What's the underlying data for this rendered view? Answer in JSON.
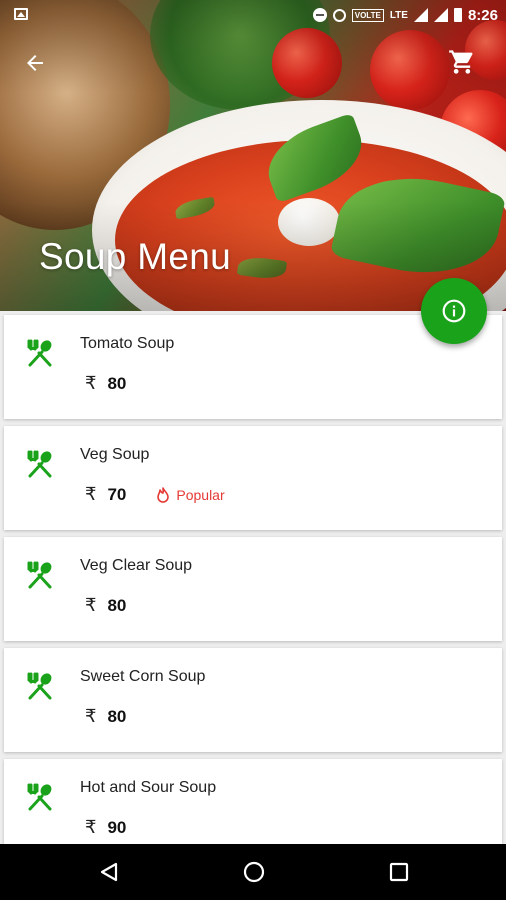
{
  "status_bar": {
    "time": "8:26",
    "volte": "VOLTE",
    "network": "LTE"
  },
  "header": {
    "title": "Soup Menu"
  },
  "colors": {
    "accent": "#1aa31a",
    "popular": "#e53935",
    "card_bg": "#ffffff",
    "nav_bg": "#000000"
  },
  "icons": {
    "back": "arrow-back-icon",
    "cart": "shopping-cart-icon",
    "info": "info-icon",
    "item": "fork-spoon-icon",
    "popular": "fire-icon"
  },
  "menu": {
    "items": [
      {
        "name": "Tomato Soup",
        "currency": "₹",
        "price": "80",
        "badge": ""
      },
      {
        "name": "Veg Soup",
        "currency": "₹",
        "price": "70",
        "badge": "Popular"
      },
      {
        "name": "Veg Clear Soup",
        "currency": "₹",
        "price": "80",
        "badge": ""
      },
      {
        "name": "Sweet Corn Soup",
        "currency": "₹",
        "price": "80",
        "badge": ""
      },
      {
        "name": "Hot and Sour Soup",
        "currency": "₹",
        "price": "90",
        "badge": ""
      }
    ]
  }
}
